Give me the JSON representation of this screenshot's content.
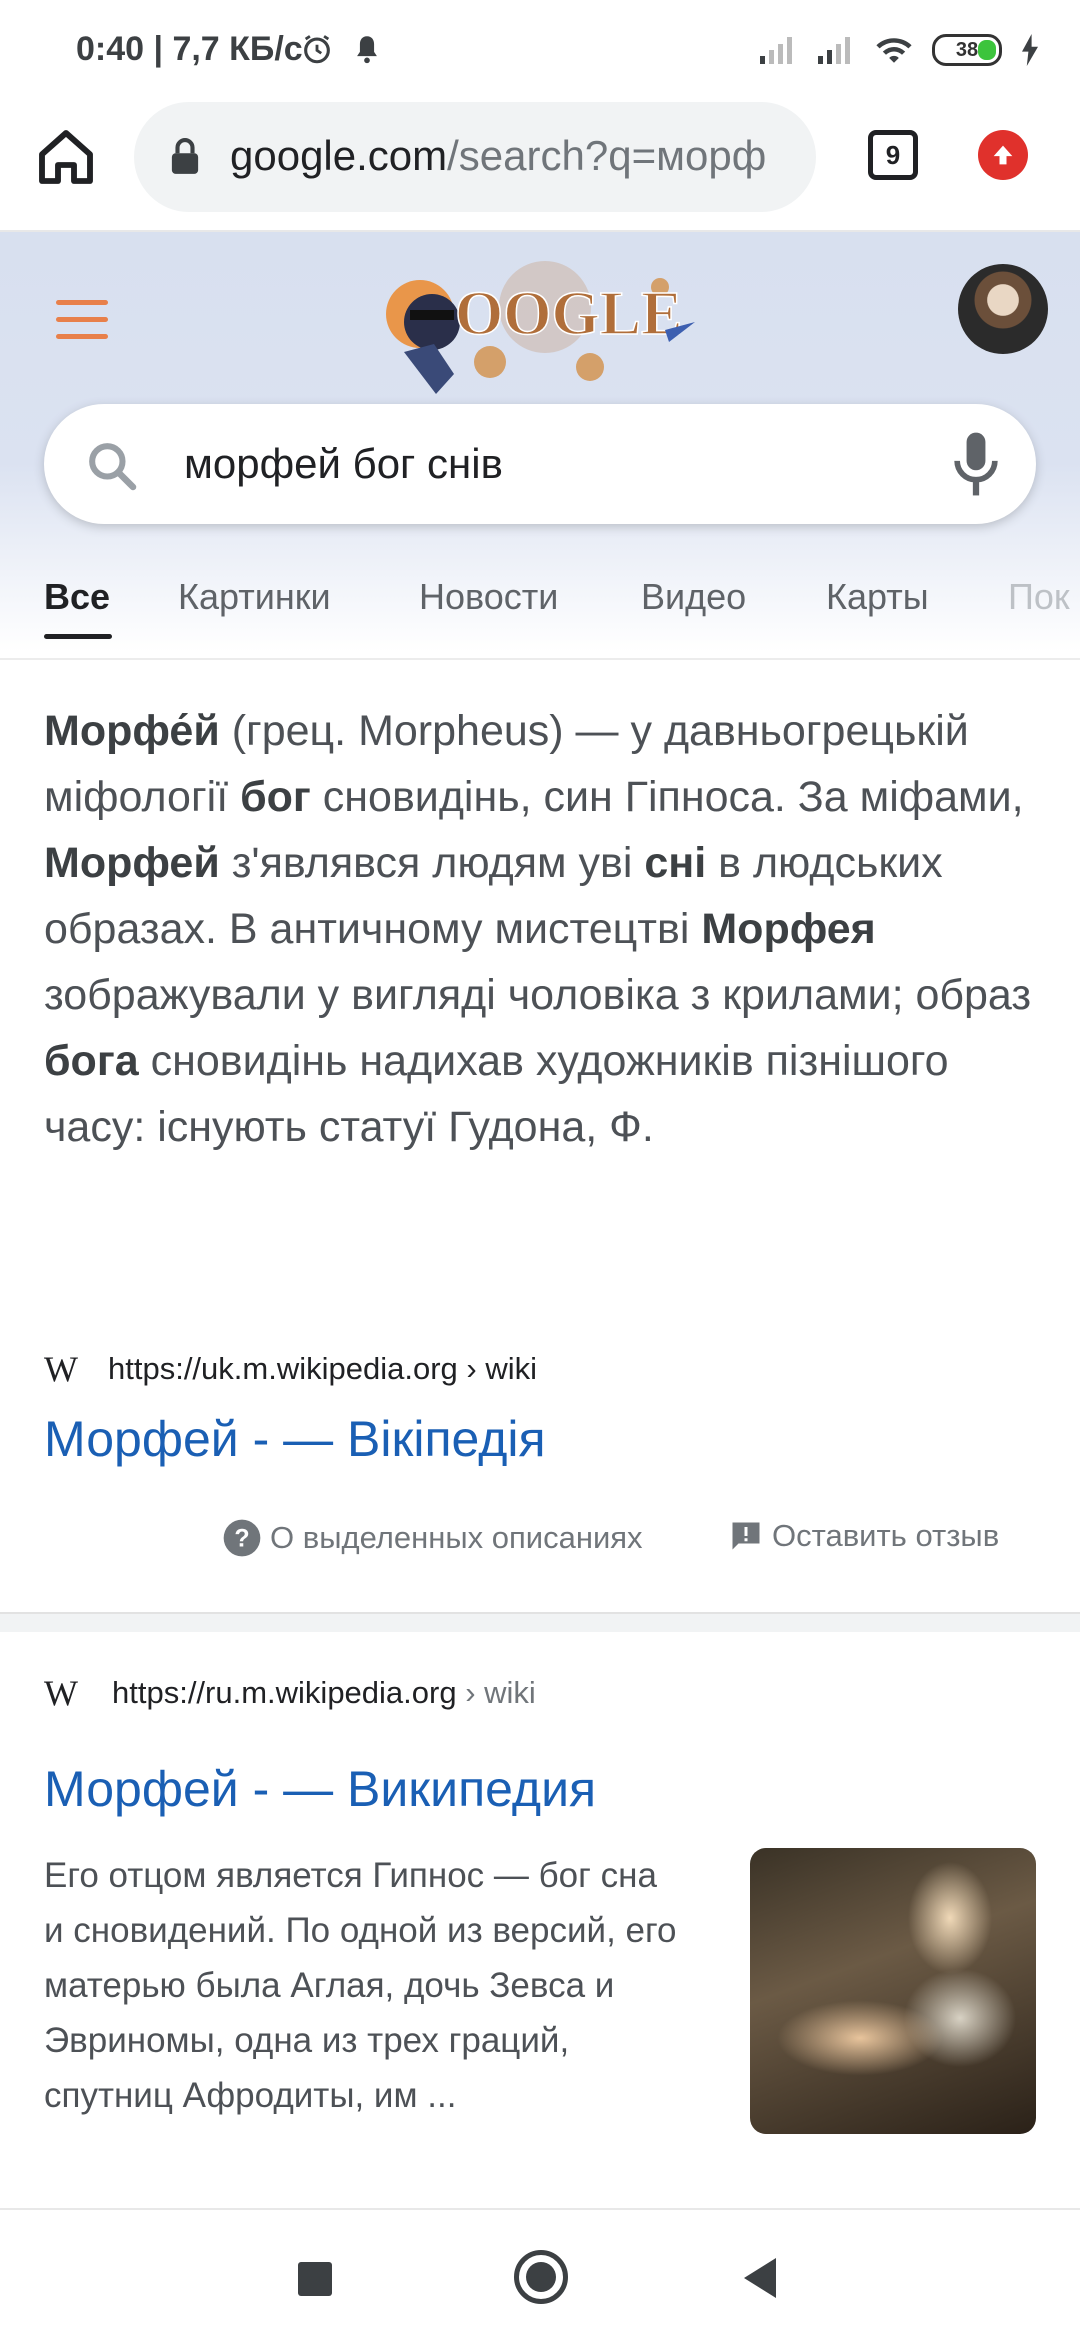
{
  "status_bar": {
    "time": "0:40 | 7,7 КБ/с",
    "battery": "38",
    "icons": [
      "alarm-icon",
      "bell-icon",
      "signal-icon",
      "signal-icon",
      "wifi-icon",
      "battery-icon",
      "charging-icon"
    ]
  },
  "browser": {
    "url_domain": "google.com",
    "url_path": "/search?q=морф",
    "tab_count": "9",
    "icons": [
      "home-icon",
      "lock-icon",
      "tabs-icon",
      "update-icon"
    ]
  },
  "search": {
    "query": "морфей бог снів",
    "icons": [
      "menu-icon",
      "search-icon",
      "mic-icon"
    ],
    "doodle_text": "OOGLE"
  },
  "tabs": [
    "Все",
    "Картинки",
    "Новости",
    "Видео",
    "Карты",
    "Пок"
  ],
  "featured": {
    "p1_b1": "Морфе́й",
    "p1_t1": " (грец. Morpheus) — у давньогрецькій міфології ",
    "p1_b2": "бог",
    "p1_t2": " сновидінь, син Гіпноса. За міфами, ",
    "p1_b3": "Морфей",
    "p1_t3": " з'являвся людям уві ",
    "p1_b4": "сні",
    "p1_t4": " в людських образах. В античному мистецтві ",
    "p1_b5": "Морфея",
    "p1_t5": " зображували у вигляді чоловіка з крилами; образ ",
    "p1_b6": "бога",
    "p1_t6": " сновидінь надихав художників пізнішого часу: існують статуї Гудона, Ф.",
    "source_url": "https://uk.m.wikipedia.org › wiki",
    "title": "Морфей - — Вікіпедія",
    "about_label": "О выделенных описаниях",
    "feedback_label": "Оставить отзыв"
  },
  "result2": {
    "source_url": "https://ru.m.wikipedia.org",
    "source_path": " › wiki",
    "title": "Морфей - — Википедия",
    "snippet": "Его отцом является Гипнос — бог сна и сновидений. По одной из версий, его матерью была Аглая, дочь Зевса и Эвриномы, одна из трех граций, спутниц Афродиты, им ..."
  },
  "colors": {
    "link": "#1a5fb4",
    "menu_accent": "#e8804a",
    "update_red": "#e0312c",
    "battery_green": "#3cc43c"
  }
}
